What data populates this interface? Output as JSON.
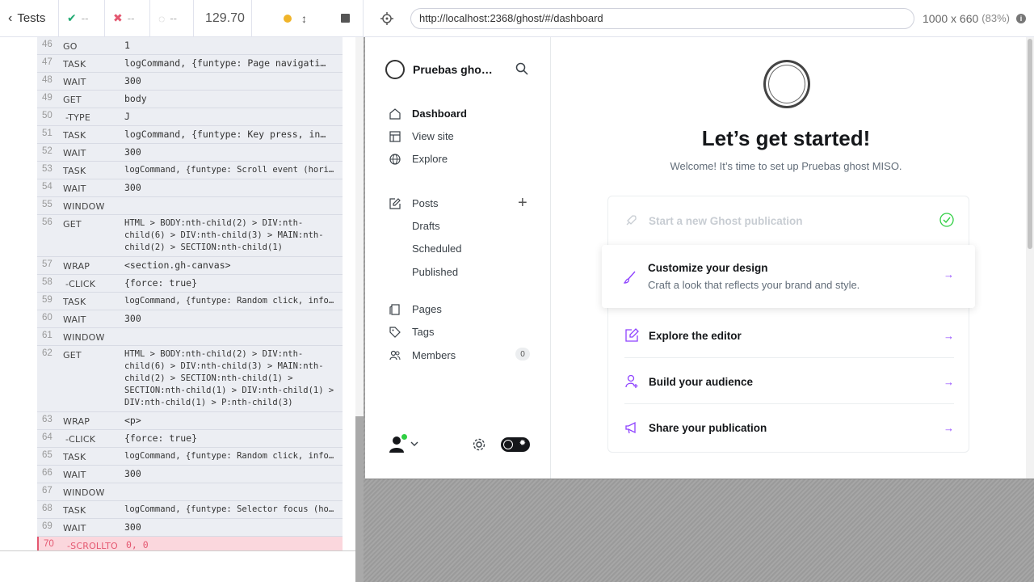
{
  "reporter": {
    "tests_label": "Tests",
    "passed": "--",
    "failed": "--",
    "pending": "--",
    "duration": "129.70"
  },
  "commands": [
    {
      "num": "46",
      "name": "GO",
      "msg": "1",
      "child": false
    },
    {
      "num": "47",
      "name": "TASK",
      "msg": "logCommand, {funtype: Page navigati…",
      "child": false
    },
    {
      "num": "48",
      "name": "WAIT",
      "msg": "300",
      "child": false
    },
    {
      "num": "49",
      "name": "GET",
      "msg": "body",
      "child": false
    },
    {
      "num": "50",
      "name": "-TYPE",
      "msg": "J",
      "child": true
    },
    {
      "num": "51",
      "name": "TASK",
      "msg": "logCommand, {funtype: Key press, in…",
      "child": false
    },
    {
      "num": "52",
      "name": "WAIT",
      "msg": "300",
      "child": false
    },
    {
      "num": "53",
      "name": "TASK",
      "msg": "logCommand, {funtype: Scroll event (horiz…",
      "child": false,
      "small": true
    },
    {
      "num": "54",
      "name": "WAIT",
      "msg": "300",
      "child": false
    },
    {
      "num": "55",
      "name": "WINDOW",
      "msg": "",
      "child": false
    },
    {
      "num": "56",
      "name": "GET",
      "msg": "HTML > BODY:nth-child(2) > DIV:nth-child(6) > DIV:nth-child(3) > MAIN:nth-child(2) > SECTION:nth-child(1)",
      "child": false,
      "wrap": true
    },
    {
      "num": "57",
      "name": "WRAP",
      "msg": "<section.gh-canvas>",
      "child": false
    },
    {
      "num": "58",
      "name": "-CLICK",
      "msg": "{force: true}",
      "child": true
    },
    {
      "num": "59",
      "name": "TASK",
      "msg": "logCommand, {funtype: Random click, info:…",
      "child": false,
      "small": true
    },
    {
      "num": "60",
      "name": "WAIT",
      "msg": "300",
      "child": false
    },
    {
      "num": "61",
      "name": "WINDOW",
      "msg": "",
      "child": false
    },
    {
      "num": "62",
      "name": "GET",
      "msg": "HTML > BODY:nth-child(2) > DIV:nth-child(6) > DIV:nth-child(3) > MAIN:nth-child(2) > SECTION:nth-child(1) > SECTION:nth-child(1) > DIV:nth-child(1) > DIV:nth-child(1) > P:nth-child(3)",
      "child": false,
      "wrap": true
    },
    {
      "num": "63",
      "name": "WRAP",
      "msg": "<p>",
      "child": false
    },
    {
      "num": "64",
      "name": "-CLICK",
      "msg": "{force: true}",
      "child": true
    },
    {
      "num": "65",
      "name": "TASK",
      "msg": "logCommand, {funtype: Random click, info:…",
      "child": false,
      "small": true
    },
    {
      "num": "66",
      "name": "WAIT",
      "msg": "300",
      "child": false
    },
    {
      "num": "67",
      "name": "WINDOW",
      "msg": "",
      "child": false
    },
    {
      "num": "68",
      "name": "TASK",
      "msg": "logCommand, {funtype: Selector focus (hov…",
      "child": false,
      "small": true
    },
    {
      "num": "69",
      "name": "WAIT",
      "msg": "300",
      "child": false
    },
    {
      "num": "70",
      "name": "-SCROLLTO",
      "msg": "0, 0",
      "child": true,
      "active": true
    }
  ],
  "aut": {
    "url": "http://localhost:2368/ghost/#/dashboard",
    "viewport": "1000 x 660",
    "scale": "(83%)"
  },
  "ghost": {
    "site_name": "Pruebas ghost ...",
    "nav": {
      "dashboard": "Dashboard",
      "view_site": "View site",
      "explore": "Explore",
      "posts": "Posts",
      "drafts": "Drafts",
      "scheduled": "Scheduled",
      "published": "Published",
      "pages": "Pages",
      "tags": "Tags",
      "members": "Members",
      "members_count": "0"
    },
    "hero": {
      "title": "Let’s get started!",
      "subtitle": "Welcome! It’s time to set up Pruebas ghost MISO."
    },
    "steps": {
      "start": "Start a new Ghost publication",
      "customize_title": "Customize your design",
      "customize_desc": "Craft a look that reflects your brand and style.",
      "editor": "Explore the editor",
      "audience": "Build your audience",
      "share": "Share your publication"
    },
    "accent": "#8e42ff"
  }
}
